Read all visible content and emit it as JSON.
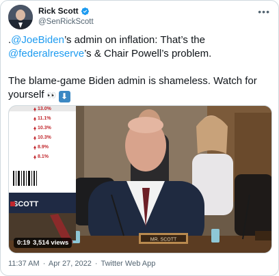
{
  "tweet": {
    "author": {
      "display_name": "Rick Scott",
      "handle": "@SenRickScott",
      "verified": true
    },
    "more_icon": "more-horizontal-icon",
    "line1_prefix": ".",
    "mention1": "@JoeBiden",
    "line1_suffix": "’s admin on inflation: That’s the",
    "mention2": "@federalreserve",
    "line2_suffix": "’s & Chair Powell’s problem.",
    "line3": "The blame-game Biden admin is shameless. Watch for yourself",
    "emoji_eyes": "👀",
    "emoji_arrow": "⬇",
    "video": {
      "elapsed": "0:19",
      "views": "3,514 views",
      "nameplate": "MR. SCOTT",
      "sign_brand": "SCOTT",
      "sign_values": [
        "13.0%",
        "11.1%",
        "10.3%",
        "10.3%",
        "8.9%",
        "8.1%"
      ]
    },
    "timestamp": "11:37 AM",
    "separator1": "·",
    "date": "Apr 27, 2022",
    "separator2": "·",
    "source": "Twitter Web App"
  },
  "colors": {
    "link": "#1d9bf0",
    "verified": "#1d9bf0",
    "secondary_text": "#536471"
  }
}
